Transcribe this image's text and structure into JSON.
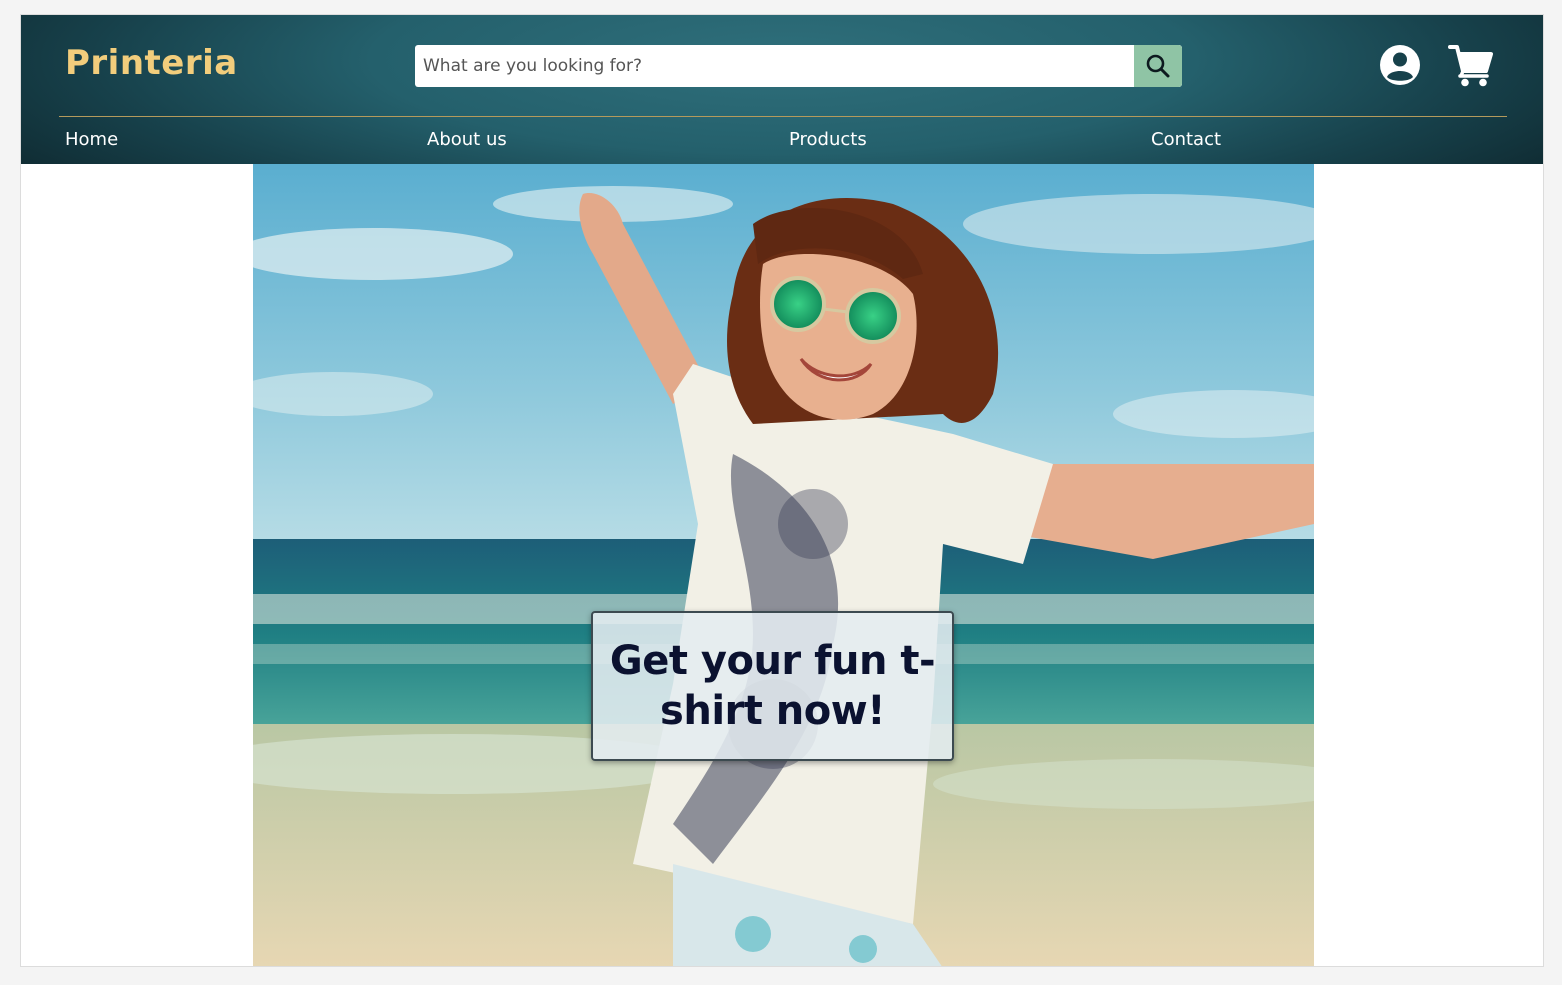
{
  "header": {
    "logo": "Printeria",
    "search": {
      "placeholder": "What are you looking for?",
      "value": ""
    },
    "icons": [
      "search-icon",
      "account-circle-icon",
      "shopping-cart-icon"
    ]
  },
  "nav": {
    "items": [
      "Home",
      "About us",
      "Products",
      "Contact"
    ]
  },
  "hero": {
    "image": "woman-jumping-on-beach-photo",
    "cta": "Get your fun t- shirt now!"
  },
  "colors": {
    "header_dark": "#0f2a31",
    "header_light": "#2f6f7b",
    "logo": "#f2cd7c",
    "search_button": "#8fc4a5",
    "divider": "#b49a5c",
    "cta_text": "#0b1230"
  }
}
